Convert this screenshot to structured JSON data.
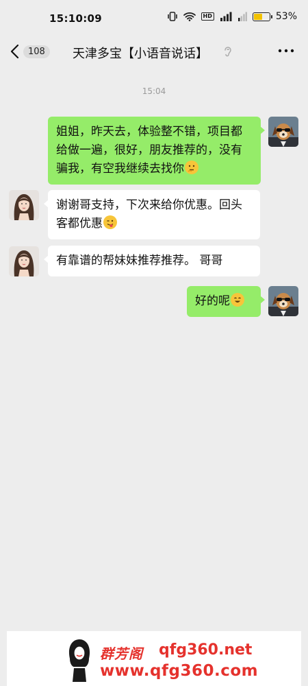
{
  "status_bar": {
    "time": "15:10:09",
    "battery_percent_label": "53%",
    "battery_level": 0.53,
    "icons": [
      "vibrate-icon",
      "wifi-icon",
      "hd-icon",
      "signal-icon",
      "signal-weak-icon",
      "battery-icon"
    ]
  },
  "header": {
    "unread_count": "108",
    "title": "天津多宝【小语音说话】",
    "icons": [
      "back-chevron-icon",
      "ear-icon",
      "more-icon"
    ]
  },
  "chat": {
    "timestamp": "15:04",
    "messages": [
      {
        "sender": "me",
        "text": "姐姐，昨天去，体验整不错，项目都给做一遍，很好，朋友推荐的，没有骗我，有空我继续去找你",
        "emoji": "thinking-emoji"
      },
      {
        "sender": "other",
        "text": "谢谢哥支持，下次来给你优惠。回头客都优惠",
        "emoji": "wink-tongue-emoji"
      },
      {
        "sender": "other",
        "text": "有靠谱的帮妹妹推荐推荐。 哥哥",
        "emoji": ""
      },
      {
        "sender": "me",
        "text": "好的呢",
        "emoji": "grin-emoji"
      }
    ]
  },
  "watermark": {
    "brand": "群芳阁",
    "url1": "qfg360.net",
    "url2": "www.qfg360.com"
  },
  "colors": {
    "background": "#ededed",
    "my_bubble": "#95ec69",
    "other_bubble": "#ffffff",
    "watermark_red": "#e5322d",
    "battery_fill": "#f2c200"
  }
}
